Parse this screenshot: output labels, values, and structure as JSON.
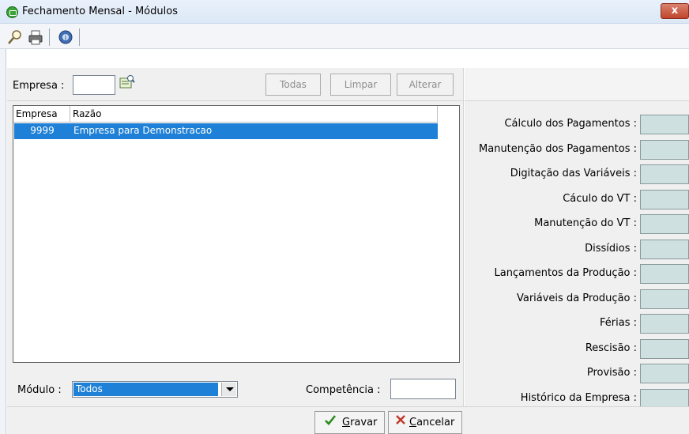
{
  "window": {
    "title": "Fechamento Mensal - Módulos",
    "close_label": "x"
  },
  "toolbar": {
    "items": [
      {
        "icon": "search-icon"
      },
      {
        "icon": "printer-icon"
      },
      {
        "icon": "help-icon"
      }
    ]
  },
  "empresa_filter": {
    "label": "Empresa :",
    "value": "",
    "buttons": {
      "todas": "Todas",
      "limpar": "Limpar",
      "alterar": "Alterar"
    }
  },
  "grid": {
    "columns": [
      "Empresa",
      "Razão"
    ],
    "rows": [
      {
        "empresa": "9999",
        "razao": "Empresa para Demonstracao",
        "selected": true
      }
    ]
  },
  "modulo": {
    "label": "Módulo :",
    "selected": "Todos"
  },
  "competencia": {
    "label": "Competência :",
    "value": ""
  },
  "modules": [
    "Cálculo dos Pagamentos :",
    "Manutenção dos Pagamentos :",
    "Digitação das Variáveis :",
    "Cáculo do VT :",
    "Manutenção do VT :",
    "Dissídios :",
    "Lançamentos da Produção :",
    "Variáveis da Produção :",
    "Férias :",
    "Rescisão :",
    "Provisão :",
    "Histórico da Empresa :"
  ],
  "actions": {
    "gravar_prefix": "",
    "gravar_underline": "G",
    "gravar_rest": "ravar",
    "cancelar_underline": "C",
    "cancelar_rest": "ancelar"
  },
  "colors": {
    "selection": "#1e80d6",
    "module_box": "#cfe0e0",
    "close": "#c0452c"
  }
}
